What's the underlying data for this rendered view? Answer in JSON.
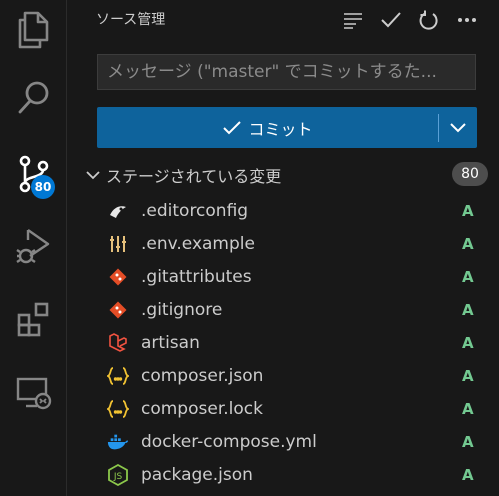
{
  "activity_bar": {
    "items": [
      {
        "name": "explorer"
      },
      {
        "name": "search"
      },
      {
        "name": "source-control",
        "badge": "80"
      },
      {
        "name": "run-debug"
      },
      {
        "name": "extensions"
      },
      {
        "name": "remote-explorer"
      }
    ],
    "accent_color": "#0078d4"
  },
  "sidebar": {
    "title": "ソース管理",
    "commit_input": {
      "placeholder": "メッセージ (\"master\" でコミットするた..."
    },
    "commit_button": {
      "label": "コミット",
      "color": "#0e639c"
    },
    "section": {
      "title": "ステージされている変更",
      "count": "80"
    },
    "files": [
      {
        "name": ".editorconfig",
        "status": "A",
        "icon": "editorconfig-icon"
      },
      {
        "name": ".env.example",
        "status": "A",
        "icon": "env-icon"
      },
      {
        "name": ".gitattributes",
        "status": "A",
        "icon": "git-icon"
      },
      {
        "name": ".gitignore",
        "status": "A",
        "icon": "git-icon"
      },
      {
        "name": "artisan",
        "status": "A",
        "icon": "laravel-icon"
      },
      {
        "name": "composer.json",
        "status": "A",
        "icon": "json-icon"
      },
      {
        "name": "composer.lock",
        "status": "A",
        "icon": "json-icon"
      },
      {
        "name": "docker-compose.yml",
        "status": "A",
        "icon": "docker-icon"
      },
      {
        "name": "package.json",
        "status": "A",
        "icon": "nodejs-icon"
      }
    ],
    "status_color": "#73c991"
  }
}
